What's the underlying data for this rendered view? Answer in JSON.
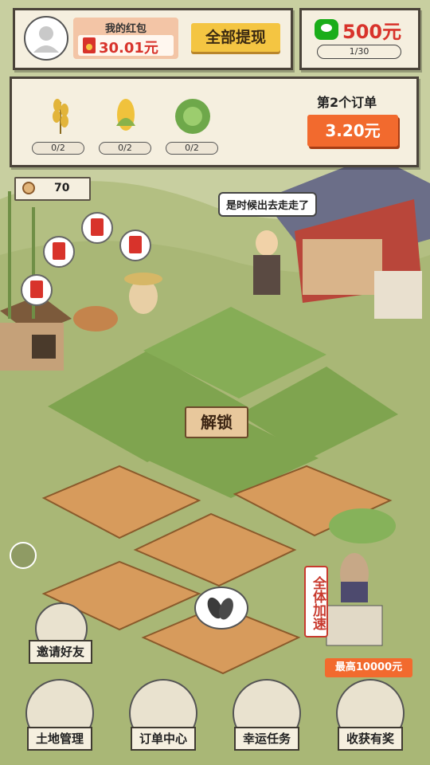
{
  "header": {
    "red_packet_title": "我的红包",
    "red_packet_amount": "30.01元",
    "withdraw_all_label": "全部提现",
    "wechat_reward_amount": "500元",
    "wechat_progress": "1/30"
  },
  "order": {
    "crops": [
      {
        "name": "wheat-icon",
        "count": "0/2"
      },
      {
        "name": "corn-icon",
        "count": "0/2"
      },
      {
        "name": "cabbage-icon",
        "count": "0/2"
      }
    ],
    "title": "第2个订单",
    "reward": "3.20元"
  },
  "coins": {
    "count": "70"
  },
  "npc_bubble": "是时候出去走走了",
  "field": {
    "unlock_label": "解锁"
  },
  "speedup_label": "全体加速",
  "max_reward_label": "最高10000元",
  "menu": {
    "invite_friends": "邀请好友",
    "land_management": "土地管理",
    "order_center": "订单中心",
    "lucky_tasks": "幸运任务",
    "harvest_reward": "收获有奖"
  },
  "colors": {
    "accent_orange": "#f26a2e",
    "gold": "#f4c542",
    "red": "#d8332b",
    "grass": "#b9c48a"
  }
}
